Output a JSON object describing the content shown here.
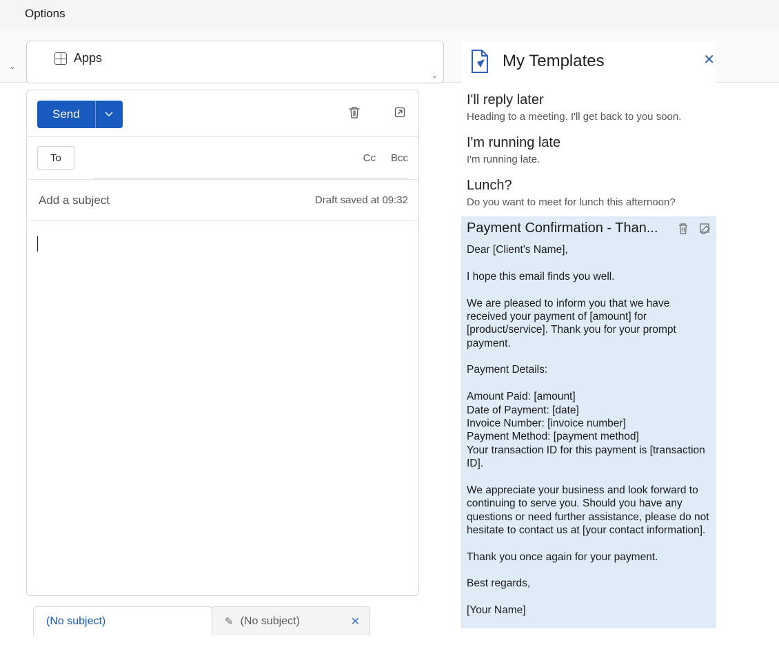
{
  "topbar": {
    "options_label": "Options"
  },
  "ribbon": {
    "apps_label": "Apps"
  },
  "compose": {
    "send_label": "Send",
    "to_label": "To",
    "cc_label": "Cc",
    "bcc_label": "Bcc",
    "subject_placeholder": "Add a subject",
    "subject_value": "",
    "draft_saved": "Draft saved at 09:32",
    "body_text": ""
  },
  "draft_tabs": {
    "tab1": "(No subject)",
    "tab2": "(No subject)"
  },
  "templates": {
    "title": "My Templates",
    "items": [
      {
        "title": "I'll reply later",
        "preview": "Heading to a meeting. I'll get back to you soon."
      },
      {
        "title": "I'm running late",
        "preview": "I'm running late."
      },
      {
        "title": "Lunch?",
        "preview": "Do you want to meet for lunch this afternoon?"
      }
    ],
    "selected": {
      "title": "Payment Confirmation - Than...",
      "body": "Dear [Client's Name],\n\nI hope this email finds you well.\n\nWe are pleased to inform you that we have received your payment of [amount] for [product/service]. Thank you for your prompt payment.\n\nPayment Details:\n\nAmount Paid: [amount]\nDate of Payment: [date]\nInvoice Number: [invoice number]\nPayment Method: [payment method]\nYour transaction ID for this payment is [transaction ID].\n\nWe appreciate your business and look forward to continuing to serve you. Should you have any questions or need further assistance, please do not hesitate to contact us at [your contact information].\n\nThank you once again for your payment.\n\nBest regards,\n\n[Your Name]"
    }
  },
  "colors": {
    "accent": "#185abd",
    "panel_highlight": "#dfecf7"
  }
}
